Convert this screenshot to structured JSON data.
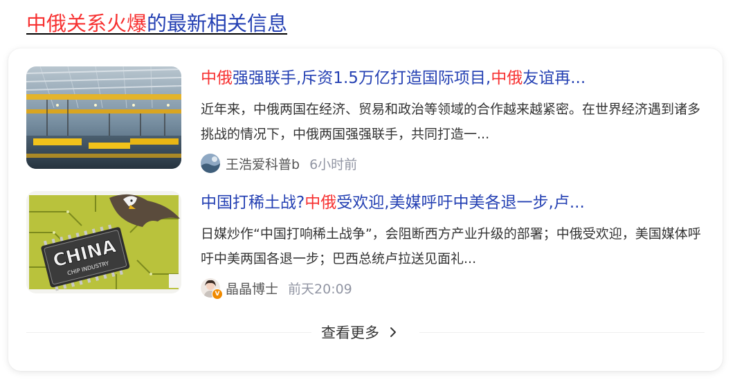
{
  "header": {
    "title_highlight": "中俄关系火爆",
    "title_rest": "的最新相关信息"
  },
  "items": [
    {
      "title_parts": [
        {
          "text": "中俄",
          "highlight": true
        },
        {
          "text": "强强联手,斥资1.5万亿打造国际项目,",
          "highlight": false
        },
        {
          "text": "中俄",
          "highlight": true
        },
        {
          "text": "友谊再...",
          "highlight": false
        }
      ],
      "summary": "近年来，中俄两国在经济、贸易和政治等领域的合作越来越紧密。在世界经济遇到诸多挑战的情况下，中俄两国强强联手，共同打造一...",
      "author": "王浩爱科普b",
      "time": "6小时前",
      "thumb_icon": "factory-crane-image"
    },
    {
      "title_parts": [
        {
          "text": "中国打稀土战?",
          "highlight": false
        },
        {
          "text": "中俄",
          "highlight": true
        },
        {
          "text": "受欢迎,美媒呼吁中美各退一步,卢...",
          "highlight": false
        }
      ],
      "summary": "日媒炒作“中国打响稀土战争”，会阻断西方产业升级的部署；中俄受欢迎，美国媒体呼吁中美两国各退一步；巴西总统卢拉送见面礼...",
      "author": "晶晶博士",
      "time": "前天20:09",
      "thumb_icon": "china-chip-image",
      "chip_text": "CHINA",
      "chip_subtext": "CHIP INDUSTRY",
      "verified_badge": "V"
    }
  ],
  "see_more": {
    "label": "查看更多",
    "icon": "chevron-right-icon"
  },
  "colors": {
    "highlight": "#f73131",
    "link": "#2440b3",
    "text": "#333333",
    "muted": "#9195a3"
  }
}
